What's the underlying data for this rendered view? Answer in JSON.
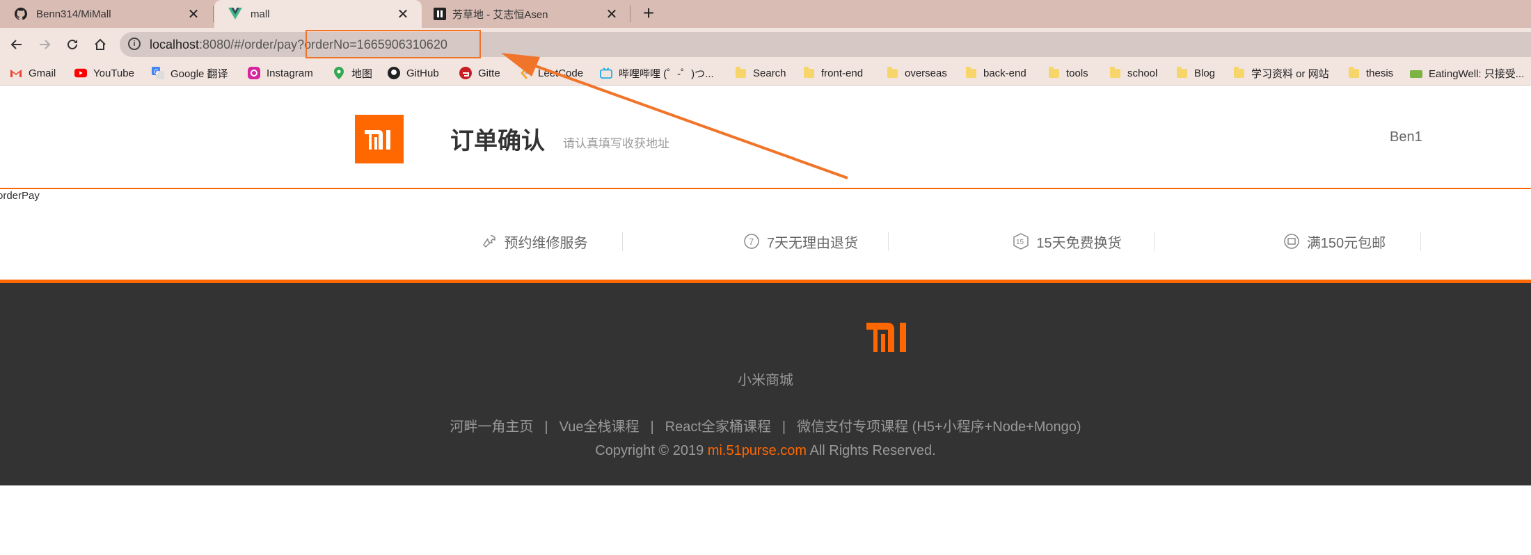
{
  "browser": {
    "tabs": [
      {
        "title": "Benn314/MiMall",
        "icon": "github-icon"
      },
      {
        "title": "mall",
        "icon": "vue-icon"
      },
      {
        "title": "芳草地 - 艾志恒Asen",
        "icon": "asen-icon"
      }
    ],
    "url_host": "localhost",
    "url_rest": ":8080/#/order/pay?orderNo=1665906310620",
    "bookmarks": [
      {
        "label": "Gmail",
        "icon": "gmail-icon"
      },
      {
        "label": "YouTube",
        "icon": "youtube-icon"
      },
      {
        "label": "Google 翻译",
        "icon": "translate-icon"
      },
      {
        "label": "Instagram",
        "icon": "instagram-icon"
      },
      {
        "label": "地图",
        "icon": "maps-icon"
      },
      {
        "label": "GitHub",
        "icon": "github-icon"
      },
      {
        "label": "Gitte",
        "icon": "gitee-icon"
      },
      {
        "label": "LeetCode",
        "icon": "leetcode-icon"
      },
      {
        "label": "哔哩哔哩 (゜-゜)つ...",
        "icon": "bilibili-icon"
      },
      {
        "label": "Search",
        "icon": "folder-icon"
      },
      {
        "label": "front-end",
        "icon": "folder-icon"
      },
      {
        "label": "overseas",
        "icon": "folder-icon"
      },
      {
        "label": "back-end",
        "icon": "folder-icon"
      },
      {
        "label": "tools",
        "icon": "folder-icon"
      },
      {
        "label": "school",
        "icon": "folder-icon"
      },
      {
        "label": "Blog",
        "icon": "folder-icon"
      },
      {
        "label": "学习资料 or 网站",
        "icon": "folder-icon"
      },
      {
        "label": "thesis",
        "icon": "folder-icon"
      },
      {
        "label": "EatingWell: 只接受...",
        "icon": "eatingwell-icon"
      }
    ]
  },
  "header": {
    "logo_text": "mi",
    "title": "订单确认",
    "subtitle": "请认真填写收获地址",
    "username": "Ben1"
  },
  "route_name": "orderPay",
  "services": [
    {
      "label": "预约维修服务",
      "icon": "wrench-icon"
    },
    {
      "label": "7天无理由退货",
      "icon": "seven-day-icon"
    },
    {
      "label": "15天免费换货",
      "icon": "fifteen-day-icon"
    },
    {
      "label": "满150元包邮",
      "icon": "shipping-icon"
    }
  ],
  "footer": {
    "brand": "小米商城",
    "links": [
      "河畔一角主页",
      "Vue全栈课程",
      "React全家桶课程",
      "微信支付专项课程 (H5+小程序+Node+Mongo)"
    ],
    "link_separator": "|",
    "copyright_prefix": "Copyright © 2019 ",
    "copyright_site": "mi.51purse.com",
    "copyright_suffix": " All Rights Reserved."
  },
  "colors": {
    "accent": "#ff6700",
    "footer_bg": "#333333",
    "annotation": "#f0752a"
  }
}
